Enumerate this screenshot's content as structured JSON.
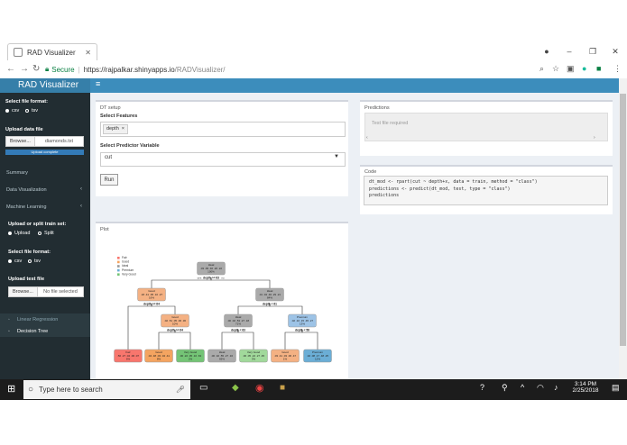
{
  "browser": {
    "tab_title": "RAD Visualizer",
    "secure_label": "Secure",
    "url_host": "https://rajpalkar.shinyapps.io",
    "url_path": "/RADVisualizer/"
  },
  "app": {
    "title": "RAD Visualizer",
    "header_color": "#3c8dbc",
    "sidebar_color": "#222d32"
  },
  "sidebar": {
    "file_format_label": "Select file format:",
    "format_options": [
      "csv",
      "tsv"
    ],
    "upload_label": "Upload data file",
    "browse_label": "Browse...",
    "file_name": "diamonds.txt",
    "upload_status": "Upload complete",
    "menu": [
      {
        "label": "Summary"
      },
      {
        "label": "Data Visualization"
      },
      {
        "label": "Machine Learning"
      }
    ],
    "split_label": "Upload or split train set:",
    "split_options": [
      "Upload",
      "Split"
    ],
    "test_format_label": "Select file format:",
    "test_format_options": [
      "csv",
      "tsv"
    ],
    "test_upload_label": "Upload test file",
    "test_browse_label": "Browse...",
    "test_file_placeholder": "No file selected",
    "submenu": [
      {
        "label": "Linear Regression"
      },
      {
        "label": "Decision Tree"
      }
    ]
  },
  "dt_setup": {
    "box_title": "DT setup",
    "features_label": "Select Features",
    "feature_tag": "depth",
    "predictor_label": "Select Predictor Variable",
    "predictor_value": "cut",
    "run_label": "Run"
  },
  "predictions": {
    "box_title": "Predictions",
    "placeholder": "Test file required"
  },
  "code": {
    "box_title": "Code",
    "lines": [
      "dt_mod <- rpart(cut ~ depth+x, data = train, method = \"class\")",
      "predictions <- predict(dt_mod, test, type = \"class\")",
      "predictions"
    ]
  },
  "plot": {
    "box_title": "Plot",
    "legend": [
      {
        "label": "Fair",
        "color": "#f8766d"
      },
      {
        "label": "Good",
        "color": "#f4a460"
      },
      {
        "label": "Ideal",
        "color": "#999999"
      },
      {
        "label": "Premium",
        "color": "#6baed6"
      },
      {
        "label": "Very Good",
        "color": "#74c476"
      }
    ],
    "nodes": [
      {
        "id": "root",
        "name": "Ideal",
        "probs": ".03 .09 .40 .26 .22",
        "pct": "100%",
        "color": "#aaaaaa"
      },
      {
        "id": "n2",
        "name": "Good",
        "probs": ".18 .41 .05 .10 .27",
        "pct": "16%",
        "color": "#f4b183"
      },
      {
        "id": "n3",
        "name": "Ideal",
        "probs": ".01 .04 .46 .29 .21",
        "pct": "84%",
        "color": "#aaaaaa"
      },
      {
        "id": "n5",
        "name": "Good",
        "probs": ".02 .51 .05 .06 .36",
        "pct": "10%",
        "color": "#f4b183"
      },
      {
        "id": "n6",
        "name": "Ideal",
        "probs": ".00 .02 .53 .27 .18",
        "pct": "71%",
        "color": "#aaaaaa"
      },
      {
        "id": "n7",
        "name": "Premium",
        "probs": ".02 .10 .15 .45 .27",
        "pct": "13%",
        "color": "#9dc3e6"
      },
      {
        "id": "l1",
        "name": "Fair",
        "probs": ".56 .27 .04 .06 .07",
        "pct": "6%",
        "color": "#f8766d"
      },
      {
        "id": "l2",
        "name": "Good",
        "probs": ".04 .48 .03 .04 .41",
        "pct": "8%",
        "color": "#f4a460"
      },
      {
        "id": "l3",
        "name": "Very Good",
        "probs": ".00 .22 .05 .10 .63",
        "pct": "2%",
        "color": "#74c476"
      },
      {
        "id": "l4",
        "name": "Ideal",
        "probs": ".00 .02 .55 .27 .16",
        "pct": "69%",
        "color": "#aaaaaa"
      },
      {
        "id": "l5",
        "name": "Very Good",
        "probs": ".00 .05 .24 .27 .45",
        "pct": "3%",
        "color": "#a1d99b"
      },
      {
        "id": "l6",
        "name": "Good",
        "probs": ".03 .41 .03 .06 .47",
        "pct": "1%",
        "color": "#f4b183"
      },
      {
        "id": "l7",
        "name": "Premium",
        "probs": ".02 .08 .17 .48 .25",
        "pct": "12%",
        "color": "#6baed6"
      }
    ],
    "rules": [
      {
        "id": "r_root",
        "text": "depth >= 63"
      },
      {
        "id": "r_n2",
        "text": "depth >= 64"
      },
      {
        "id": "r_n3",
        "text": "depth < 61"
      },
      {
        "id": "r_n5",
        "text": "depth >= 64"
      },
      {
        "id": "r_n6",
        "text": "depth < 63"
      },
      {
        "id": "r_n7",
        "text": "depth < 58"
      }
    ],
    "yes_label": "yes",
    "no_label": "no"
  },
  "taskbar": {
    "search_placeholder": "Type here to search",
    "time": "3:14 PM",
    "date": "2/25/2018"
  }
}
